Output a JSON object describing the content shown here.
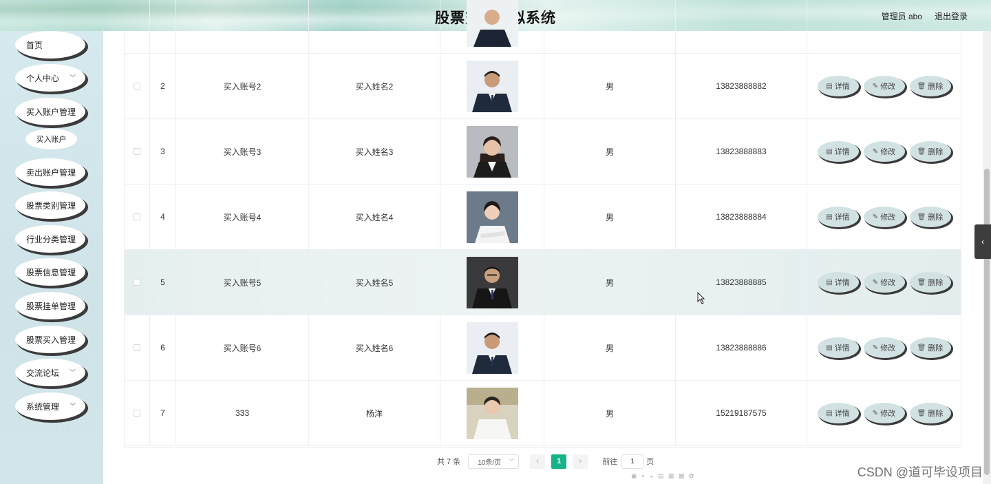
{
  "app": {
    "title": "股票交易模拟系统",
    "admin_label": "管理员 abo",
    "logout_label": "退出登录"
  },
  "sidebar": {
    "items": [
      {
        "label": "首页"
      },
      {
        "label": "个人中心"
      },
      {
        "label": "买入账户管理"
      },
      {
        "label": "卖出账户管理"
      },
      {
        "label": "股票类别管理"
      },
      {
        "label": "行业分类管理"
      },
      {
        "label": "股票信息管理"
      },
      {
        "label": "股票挂单管理"
      },
      {
        "label": "股票买入管理"
      },
      {
        "label": "交流论坛"
      },
      {
        "label": "系统管理"
      }
    ],
    "submenu": {
      "label": "买入账户"
    }
  },
  "table": {
    "rows": [
      {
        "index": "2",
        "account": "买入账号2",
        "name": "买入姓名2",
        "sex": "男",
        "phone": "13823888882"
      },
      {
        "index": "3",
        "account": "买入账号3",
        "name": "买入姓名3",
        "sex": "男",
        "phone": "13823888883"
      },
      {
        "index": "4",
        "account": "买入账号4",
        "name": "买入姓名4",
        "sex": "男",
        "phone": "13823888884"
      },
      {
        "index": "5",
        "account": "买入账号5",
        "name": "买入姓名5",
        "sex": "男",
        "phone": "13823888885"
      },
      {
        "index": "6",
        "account": "买入账号6",
        "name": "买入姓名6",
        "sex": "男",
        "phone": "13823888886"
      },
      {
        "index": "7",
        "account": "333",
        "name": "杨洋",
        "sex": "男",
        "phone": "15219187575"
      }
    ],
    "actions": {
      "detail": "详情",
      "edit": "修改",
      "delete": "删除"
    }
  },
  "pagination": {
    "total": "共 7 条",
    "page_size": "10条/页",
    "current_page": "1",
    "goto_label": "前往",
    "goto_value": "1",
    "page_suffix": "页"
  },
  "watermark": "CSDN @道可毕设项目",
  "colors": {
    "accent": "#17b48a",
    "sidebar_bg": "#d6e9ee",
    "op_button": "#d2e2e3"
  }
}
